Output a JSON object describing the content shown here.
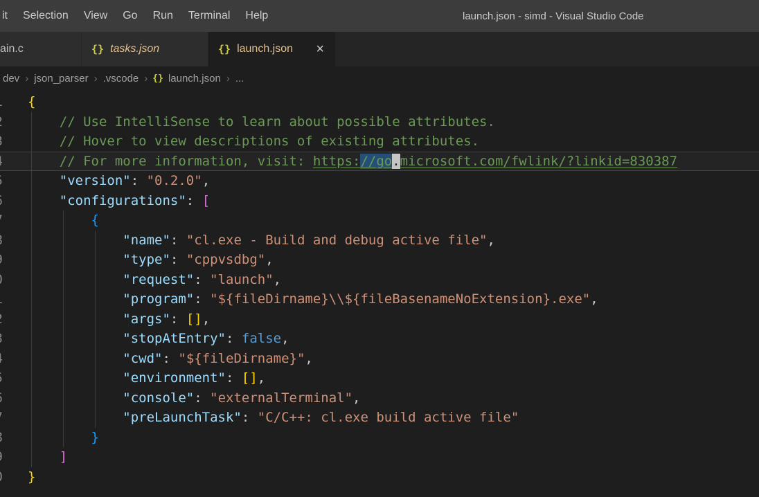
{
  "window": {
    "title": "launch.json - simd - Visual Studio Code"
  },
  "menu_bar": {
    "items": [
      "it",
      "Selection",
      "View",
      "Go",
      "Run",
      "Terminal",
      "Help"
    ]
  },
  "tab_bar": {
    "tabs": [
      {
        "label": "ain.c",
        "state": "inactive"
      },
      {
        "label": "tasks.json",
        "icon": "{}",
        "state": "inactive-preview-modified"
      },
      {
        "label": "launch.json",
        "icon": "{}",
        "state": "active-modified",
        "close": "×"
      }
    ]
  },
  "breadcrumb": {
    "items": [
      "dev",
      "json_parser",
      ".vscode",
      "launch.json",
      "..."
    ],
    "separator": "›",
    "file_icon": "{}"
  },
  "editor": {
    "colors": {
      "comment": "#6a9955",
      "property": "#9cdcfe",
      "string": "#ce9178",
      "keyword": "#569cd6",
      "bracket_level1": "#ffd700",
      "bracket_level2": "#da70d6",
      "bracket_level3": "#179fff",
      "selection": "#264f78",
      "modified_tab_label": "#e2c08d",
      "json_icon": "#cbcb41",
      "background": "#1e1e1e",
      "titlebar_background": "#3c3c3c"
    },
    "code": {
      "lines": [
        {
          "segs": [
            [
              "{",
              "b1"
            ]
          ]
        },
        {
          "segs": [
            [
              "    // Use IntelliSense to learn about possible attributes.",
              "cmt"
            ]
          ]
        },
        {
          "segs": [
            [
              "    // Hover to view descriptions of existing attributes.",
              "cmt"
            ]
          ]
        },
        {
          "current": true,
          "segs": [
            [
              "    // For more information, visit: ",
              "cmt"
            ],
            [
              "https:",
              "link"
            ],
            [
              "//go",
              "link sel"
            ],
            [
              ".",
              "cursor"
            ],
            [
              "microsoft.com/fwlink/?linkid=830387",
              "link"
            ]
          ]
        },
        {
          "segs": [
            [
              "    ",
              "pun"
            ],
            [
              "\"version\"",
              "key"
            ],
            [
              ": ",
              "pun"
            ],
            [
              "\"0.2.0\"",
              "str"
            ],
            [
              ",",
              "pun"
            ]
          ]
        },
        {
          "segs": [
            [
              "    ",
              "pun"
            ],
            [
              "\"configurations\"",
              "key"
            ],
            [
              ": ",
              "pun"
            ],
            [
              "[",
              "b2"
            ]
          ]
        },
        {
          "segs": [
            [
              "        ",
              "pun"
            ],
            [
              "{",
              "b3"
            ]
          ]
        },
        {
          "segs": [
            [
              "            ",
              "pun"
            ],
            [
              "\"name\"",
              "key"
            ],
            [
              ": ",
              "pun"
            ],
            [
              "\"cl.exe - Build and debug active file\"",
              "str"
            ],
            [
              ",",
              "pun"
            ]
          ]
        },
        {
          "segs": [
            [
              "            ",
              "pun"
            ],
            [
              "\"type\"",
              "key"
            ],
            [
              ": ",
              "pun"
            ],
            [
              "\"cppvsdbg\"",
              "str"
            ],
            [
              ",",
              "pun"
            ]
          ]
        },
        {
          "segs": [
            [
              "            ",
              "pun"
            ],
            [
              "\"request\"",
              "key"
            ],
            [
              ": ",
              "pun"
            ],
            [
              "\"launch\"",
              "str"
            ],
            [
              ",",
              "pun"
            ]
          ]
        },
        {
          "segs": [
            [
              "            ",
              "pun"
            ],
            [
              "\"program\"",
              "key"
            ],
            [
              ": ",
              "pun"
            ],
            [
              "\"${fileDirname}\\\\${fileBasenameNoExtension}.exe\"",
              "str"
            ],
            [
              ",",
              "pun"
            ]
          ]
        },
        {
          "segs": [
            [
              "            ",
              "pun"
            ],
            [
              "\"args\"",
              "key"
            ],
            [
              ": ",
              "pun"
            ],
            [
              "[]",
              "b1"
            ],
            [
              ",",
              "pun"
            ]
          ]
        },
        {
          "segs": [
            [
              "            ",
              "pun"
            ],
            [
              "\"stopAtEntry\"",
              "key"
            ],
            [
              ": ",
              "pun"
            ],
            [
              "false",
              "kw"
            ],
            [
              ",",
              "pun"
            ]
          ]
        },
        {
          "segs": [
            [
              "            ",
              "pun"
            ],
            [
              "\"cwd\"",
              "key"
            ],
            [
              ": ",
              "pun"
            ],
            [
              "\"${fileDirname}\"",
              "str"
            ],
            [
              ",",
              "pun"
            ]
          ]
        },
        {
          "segs": [
            [
              "            ",
              "pun"
            ],
            [
              "\"environment\"",
              "key"
            ],
            [
              ": ",
              "pun"
            ],
            [
              "[]",
              "b1"
            ],
            [
              ",",
              "pun"
            ]
          ]
        },
        {
          "segs": [
            [
              "            ",
              "pun"
            ],
            [
              "\"console\"",
              "key"
            ],
            [
              ": ",
              "pun"
            ],
            [
              "\"externalTerminal\"",
              "str"
            ],
            [
              ",",
              "pun"
            ]
          ]
        },
        {
          "segs": [
            [
              "            ",
              "pun"
            ],
            [
              "\"preLaunchTask\"",
              "key"
            ],
            [
              ": ",
              "pun"
            ],
            [
              "\"C/C++: cl.exe build active file\"",
              "str"
            ]
          ]
        },
        {
          "segs": [
            [
              "        ",
              "pun"
            ],
            [
              "}",
              "b3"
            ]
          ]
        },
        {
          "segs": [
            [
              "    ",
              "pun"
            ],
            [
              "]",
              "b2"
            ]
          ]
        },
        {
          "segs": [
            [
              "}",
              "b1"
            ]
          ]
        }
      ]
    }
  }
}
